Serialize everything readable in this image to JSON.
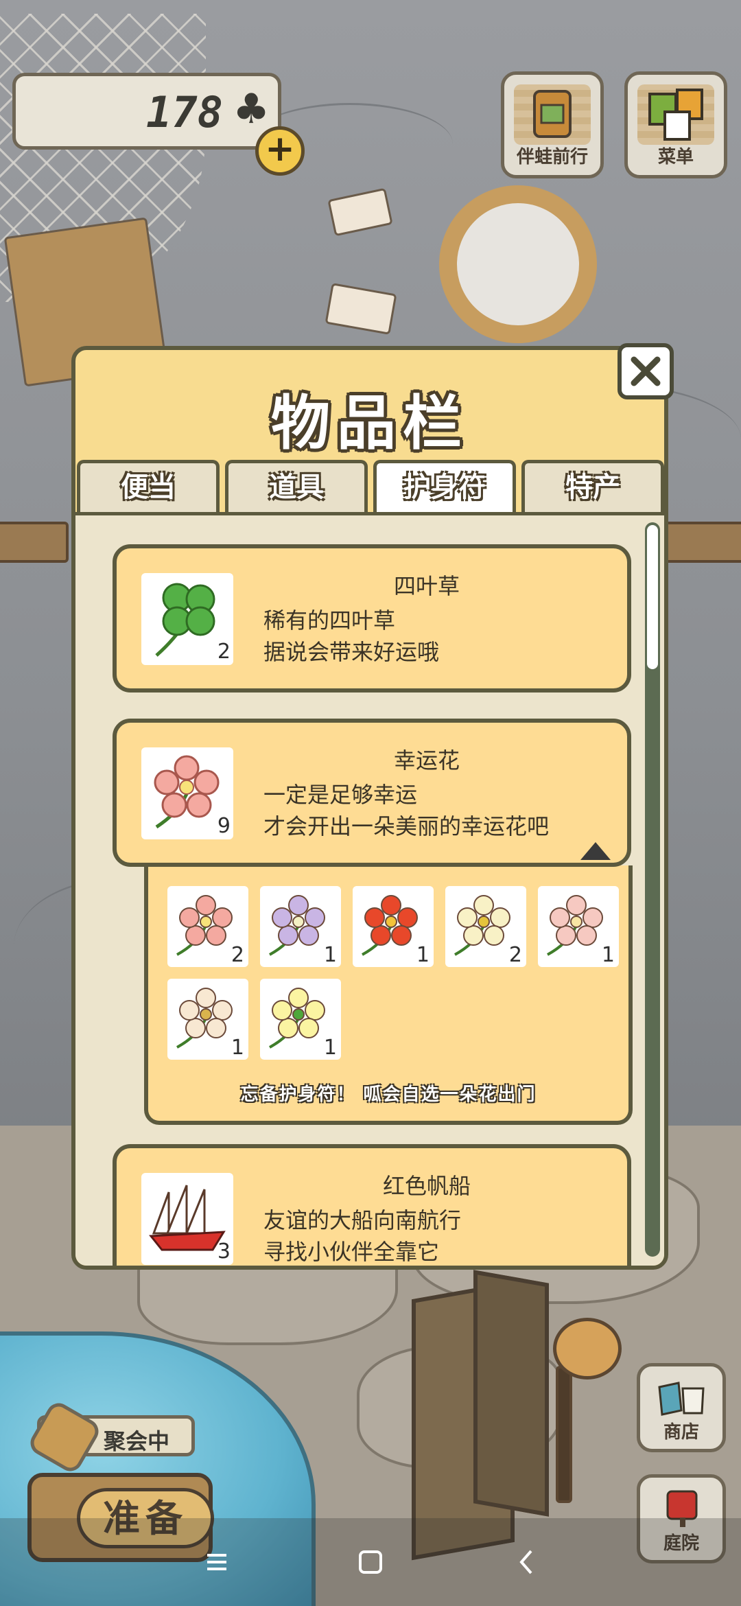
{
  "hud": {
    "clover_count": "178",
    "clover_icon": "♣",
    "add_icon": "+",
    "travel_label": "伴蛙前行",
    "menu_label": "菜单"
  },
  "dialog": {
    "title": "物品栏",
    "close_icon": "close-x",
    "tabs": [
      {
        "label": "便当",
        "active": false
      },
      {
        "label": "道具",
        "active": false
      },
      {
        "label": "护身符",
        "active": true
      },
      {
        "label": "特产",
        "active": false
      }
    ],
    "items": [
      {
        "name": "四叶草",
        "desc_line1": "稀有的四叶草",
        "desc_line2": "据说会带来好运哦",
        "quantity": "2",
        "icon": "four-leaf-clover"
      },
      {
        "name": "幸运花",
        "desc_line1": "一定是足够幸运",
        "desc_line2": "才会开出一朵美丽的幸运花吧",
        "quantity": "9",
        "icon": "lucky-flower"
      },
      {
        "name": "红色帆船",
        "desc_line1": "友谊的大船向南航行",
        "desc_line2": "寻找小伙伴全靠它",
        "quantity": "3",
        "icon": "red-sailboat"
      }
    ],
    "flower_variants": [
      {
        "color": "#f4a9a0",
        "center": "#f7e27a",
        "quantity": "2"
      },
      {
        "color": "#c9b5e4",
        "center": "#f4f1c4",
        "quantity": "1"
      },
      {
        "color": "#e8482a",
        "center": "#f3c43a",
        "quantity": "1"
      },
      {
        "color": "#f8f1c6",
        "center": "#e4c43c",
        "quantity": "2"
      },
      {
        "color": "#f6c9c1",
        "center": "#f7e6a4",
        "quantity": "1"
      },
      {
        "color": "#f8e8d2",
        "center": "#d9b44d",
        "quantity": "1"
      },
      {
        "color": "#fbf4a2",
        "center": "#4ea73b",
        "quantity": "1"
      }
    ],
    "tip": "忘备护身符！ 呱会自选一朵花出门"
  },
  "bottom": {
    "party_label": "聚会中",
    "ready_label": "准备",
    "shop_label": "商店",
    "yard_label": "庭院"
  },
  "navbar": {
    "menu_icon": "menu-lines-icon",
    "home_icon": "square-home-icon",
    "back_icon": "chevron-back-icon"
  }
}
